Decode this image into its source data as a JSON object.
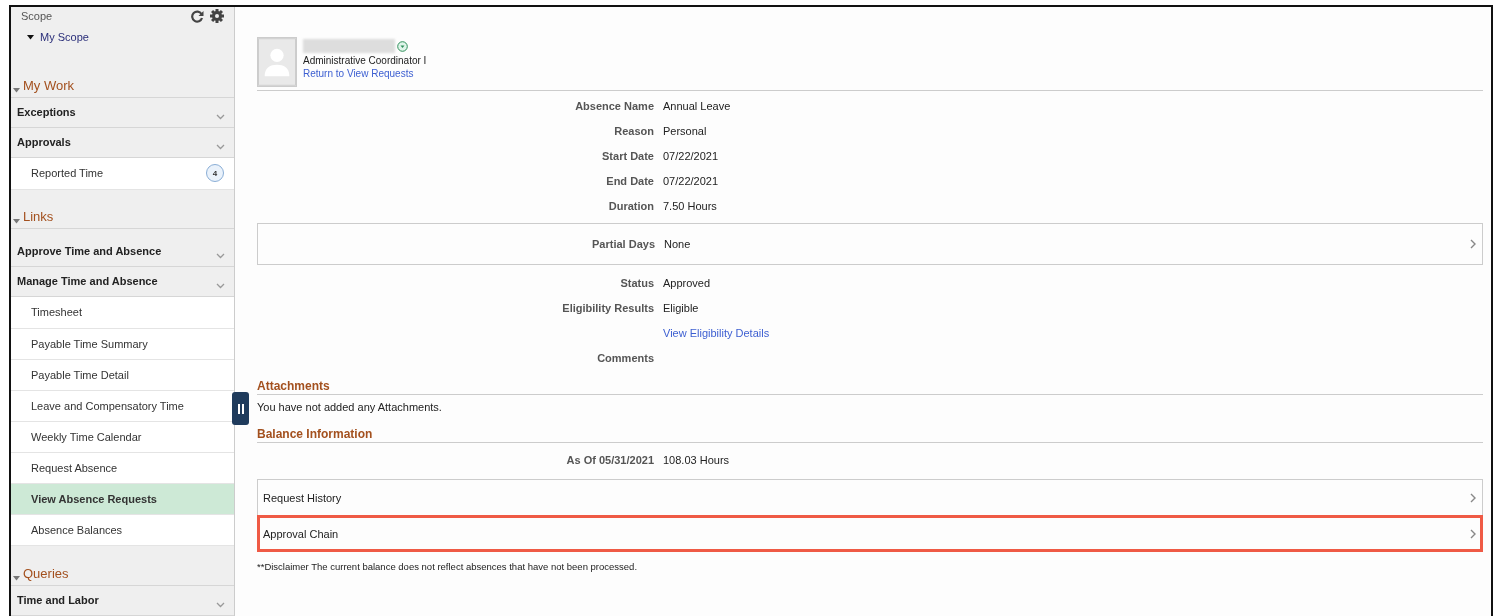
{
  "sidebar": {
    "scope_title": "Scope",
    "scope_item": {
      "label": "My Scope",
      "expanded": true
    },
    "sections": [
      {
        "title": "My Work",
        "expanded": true,
        "items": [
          {
            "label": "Exceptions",
            "kind": "group"
          },
          {
            "label": "Approvals",
            "kind": "group"
          },
          {
            "label": "Reported Time",
            "kind": "link",
            "selected": false,
            "badge": "4"
          }
        ]
      },
      {
        "title": "Links",
        "expanded": true,
        "items": [
          {
            "label": "Approve Time and Absence",
            "kind": "group"
          },
          {
            "label": "Manage Time and Absence",
            "kind": "group"
          },
          {
            "label": "Timesheet",
            "kind": "link",
            "selected": false
          },
          {
            "label": "Payable Time Summary",
            "kind": "link",
            "selected": false
          },
          {
            "label": "Payable Time Detail",
            "kind": "link",
            "selected": false
          },
          {
            "label": "Leave and Compensatory Time",
            "kind": "link",
            "selected": false
          },
          {
            "label": "Weekly Time Calendar",
            "kind": "link",
            "selected": false
          },
          {
            "label": "Request Absence",
            "kind": "link",
            "selected": false
          },
          {
            "label": "View Absence Requests",
            "kind": "link",
            "selected": true
          },
          {
            "label": "Absence Balances",
            "kind": "link",
            "selected": false
          }
        ]
      },
      {
        "title": "Queries",
        "expanded": true,
        "items": [
          {
            "label": "Time and Labor",
            "kind": "group"
          }
        ]
      }
    ]
  },
  "employee": {
    "title": "Administrative Coordinator I",
    "return_link": "Return to View Requests"
  },
  "details": [
    {
      "kind": "field",
      "label": "Absence Name",
      "value": "Annual Leave"
    },
    {
      "kind": "field",
      "label": "Reason",
      "value": "Personal"
    },
    {
      "kind": "field",
      "label": "Start Date",
      "value": "07/22/2021"
    },
    {
      "kind": "field",
      "label": "End Date",
      "value": "07/22/2021"
    },
    {
      "kind": "field",
      "label": "Duration",
      "value": "7.50 Hours"
    },
    {
      "kind": "panel",
      "label": "Partial Days",
      "value": "None"
    },
    {
      "kind": "field",
      "label": "Status",
      "value": "Approved"
    },
    {
      "kind": "field",
      "label": "Eligibility Results",
      "value": "Eligible"
    },
    {
      "kind": "link",
      "value": "View Eligibility Details"
    },
    {
      "kind": "field",
      "label": "Comments"
    }
  ],
  "attachments": {
    "title": "Attachments",
    "message": "You have not added any Attachments."
  },
  "balance": {
    "title": "Balance Information",
    "label": "As Of 05/31/2021",
    "value": "108.03 Hours"
  },
  "panels": [
    {
      "label": "Request History",
      "highlighted": false
    },
    {
      "label": "Approval Chain",
      "highlighted": true
    }
  ],
  "disclaimer": "**Disclaimer  The current balance does not reflect absences that have not been processed."
}
